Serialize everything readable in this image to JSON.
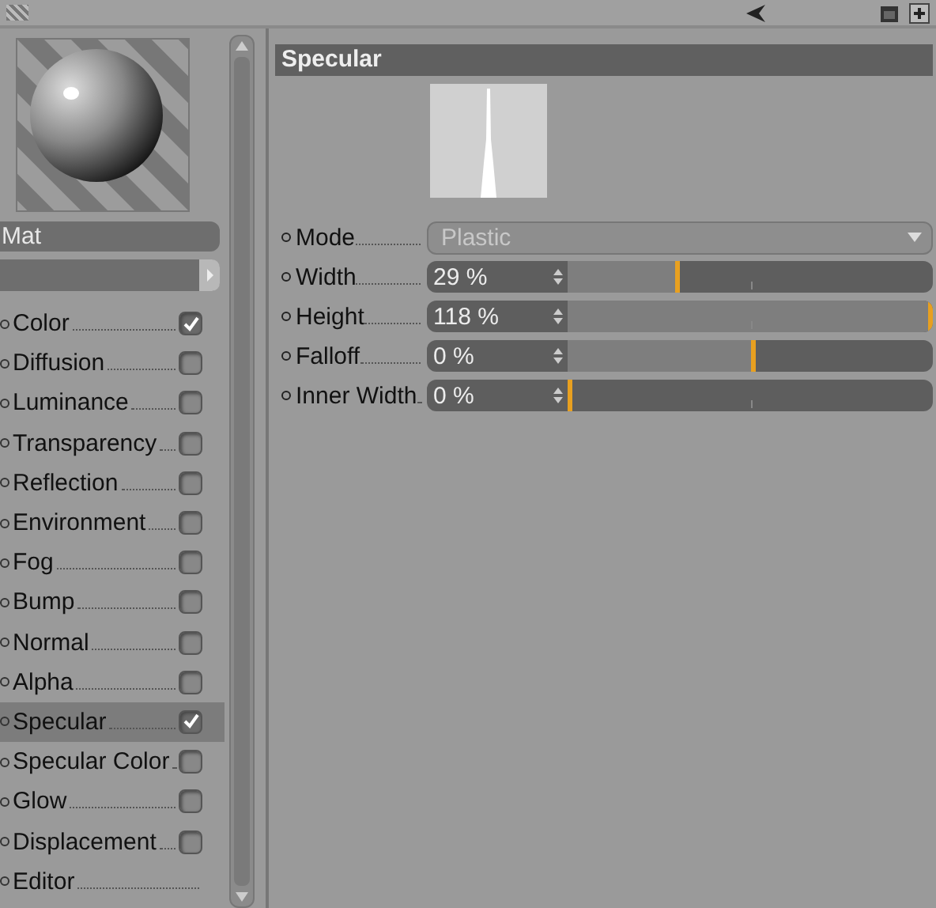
{
  "preview": {
    "name": "Mat"
  },
  "channels": [
    {
      "label": "Color",
      "kind": "check",
      "checked": true,
      "selected": false
    },
    {
      "label": "Diffusion",
      "kind": "check",
      "checked": false,
      "selected": false
    },
    {
      "label": "Luminance",
      "kind": "check",
      "checked": false,
      "selected": false
    },
    {
      "label": "Transparency",
      "kind": "check",
      "checked": false,
      "selected": false
    },
    {
      "label": "Reflection",
      "kind": "check",
      "checked": false,
      "selected": false
    },
    {
      "label": "Environment",
      "kind": "check",
      "checked": false,
      "selected": false
    },
    {
      "label": "Fog",
      "kind": "check",
      "checked": false,
      "selected": false
    },
    {
      "label": "Bump",
      "kind": "check",
      "checked": false,
      "selected": false
    },
    {
      "label": "Normal",
      "kind": "check",
      "checked": false,
      "selected": false
    },
    {
      "label": "Alpha",
      "kind": "check",
      "checked": false,
      "selected": false
    },
    {
      "label": "Specular",
      "kind": "check",
      "checked": true,
      "selected": true
    },
    {
      "label": "Specular Color",
      "kind": "check",
      "checked": false,
      "selected": false
    },
    {
      "label": "Glow",
      "kind": "check",
      "checked": false,
      "selected": false
    },
    {
      "label": "Displacement",
      "kind": "check",
      "checked": false,
      "selected": false
    },
    {
      "label": "Editor",
      "kind": "plain",
      "selected": false
    }
  ],
  "section": {
    "title": "Specular",
    "params": [
      {
        "label": "Mode",
        "kind": "dropdown",
        "value": "Plastic"
      },
      {
        "label": "Width",
        "kind": "slider",
        "value": "29 %",
        "level": 0.3
      },
      {
        "label": "Height",
        "kind": "slider",
        "value": "118 %",
        "level": 1
      },
      {
        "label": "Falloff",
        "kind": "slider",
        "value": "0 %",
        "level": 0.51
      },
      {
        "label": "Inner Width",
        "kind": "slider",
        "value": "0 %",
        "level": 0
      }
    ]
  }
}
